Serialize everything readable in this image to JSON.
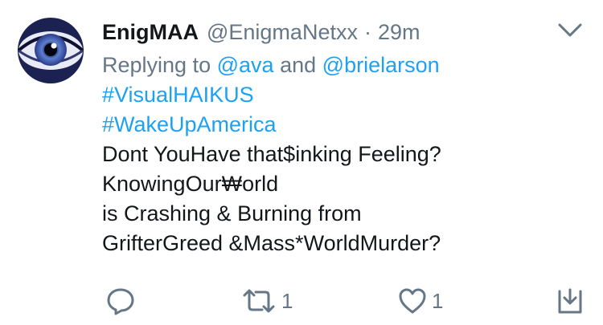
{
  "tweet": {
    "display_name": "EnigMAA",
    "handle": "@EnigmaNetxx",
    "separator": "·",
    "time": "29m",
    "reply_prefix": "Replying to",
    "reply_user_1": "@ava",
    "reply_and": "and",
    "reply_user_2": "@brielarson",
    "hashtag_1": "#VisualHAIKUS",
    "hashtag_2": "#WakeUpAmerica",
    "lines": [
      "Dont YouHave that$inking Feeling?",
      "KnowingOur₩orld",
      "is Crashing & Burning from",
      "GrifterGreed &Mass*WorldMurder?"
    ]
  },
  "actions": {
    "reply_icon": "speech-bubble-icon",
    "retweet_icon": "retweet-arrows-icon",
    "retweet_count": "1",
    "like_icon": "heart-icon",
    "like_count": "1",
    "share_icon": "share-tray-icon"
  },
  "colors": {
    "link": "#1da1f2",
    "muted": "#657786",
    "text": "#14171a"
  }
}
